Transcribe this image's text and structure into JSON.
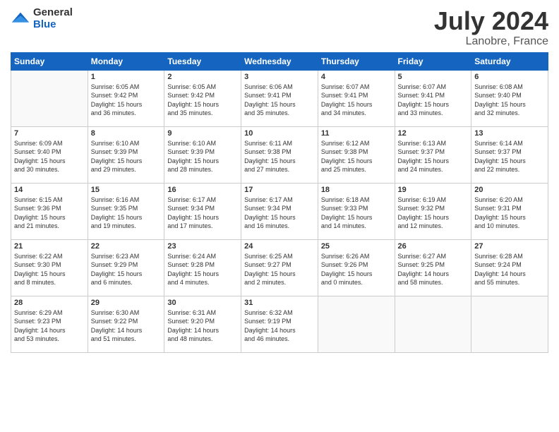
{
  "header": {
    "logo_general": "General",
    "logo_blue": "Blue",
    "month_title": "July 2024",
    "location": "Lanobre, France"
  },
  "columns": [
    "Sunday",
    "Monday",
    "Tuesday",
    "Wednesday",
    "Thursday",
    "Friday",
    "Saturday"
  ],
  "weeks": [
    [
      {
        "day": "",
        "info": ""
      },
      {
        "day": "1",
        "info": "Sunrise: 6:05 AM\nSunset: 9:42 PM\nDaylight: 15 hours\nand 36 minutes."
      },
      {
        "day": "2",
        "info": "Sunrise: 6:05 AM\nSunset: 9:42 PM\nDaylight: 15 hours\nand 35 minutes."
      },
      {
        "day": "3",
        "info": "Sunrise: 6:06 AM\nSunset: 9:41 PM\nDaylight: 15 hours\nand 35 minutes."
      },
      {
        "day": "4",
        "info": "Sunrise: 6:07 AM\nSunset: 9:41 PM\nDaylight: 15 hours\nand 34 minutes."
      },
      {
        "day": "5",
        "info": "Sunrise: 6:07 AM\nSunset: 9:41 PM\nDaylight: 15 hours\nand 33 minutes."
      },
      {
        "day": "6",
        "info": "Sunrise: 6:08 AM\nSunset: 9:40 PM\nDaylight: 15 hours\nand 32 minutes."
      }
    ],
    [
      {
        "day": "7",
        "info": "Sunrise: 6:09 AM\nSunset: 9:40 PM\nDaylight: 15 hours\nand 30 minutes."
      },
      {
        "day": "8",
        "info": "Sunrise: 6:10 AM\nSunset: 9:39 PM\nDaylight: 15 hours\nand 29 minutes."
      },
      {
        "day": "9",
        "info": "Sunrise: 6:10 AM\nSunset: 9:39 PM\nDaylight: 15 hours\nand 28 minutes."
      },
      {
        "day": "10",
        "info": "Sunrise: 6:11 AM\nSunset: 9:38 PM\nDaylight: 15 hours\nand 27 minutes."
      },
      {
        "day": "11",
        "info": "Sunrise: 6:12 AM\nSunset: 9:38 PM\nDaylight: 15 hours\nand 25 minutes."
      },
      {
        "day": "12",
        "info": "Sunrise: 6:13 AM\nSunset: 9:37 PM\nDaylight: 15 hours\nand 24 minutes."
      },
      {
        "day": "13",
        "info": "Sunrise: 6:14 AM\nSunset: 9:37 PM\nDaylight: 15 hours\nand 22 minutes."
      }
    ],
    [
      {
        "day": "14",
        "info": "Sunrise: 6:15 AM\nSunset: 9:36 PM\nDaylight: 15 hours\nand 21 minutes."
      },
      {
        "day": "15",
        "info": "Sunrise: 6:16 AM\nSunset: 9:35 PM\nDaylight: 15 hours\nand 19 minutes."
      },
      {
        "day": "16",
        "info": "Sunrise: 6:17 AM\nSunset: 9:34 PM\nDaylight: 15 hours\nand 17 minutes."
      },
      {
        "day": "17",
        "info": "Sunrise: 6:17 AM\nSunset: 9:34 PM\nDaylight: 15 hours\nand 16 minutes."
      },
      {
        "day": "18",
        "info": "Sunrise: 6:18 AM\nSunset: 9:33 PM\nDaylight: 15 hours\nand 14 minutes."
      },
      {
        "day": "19",
        "info": "Sunrise: 6:19 AM\nSunset: 9:32 PM\nDaylight: 15 hours\nand 12 minutes."
      },
      {
        "day": "20",
        "info": "Sunrise: 6:20 AM\nSunset: 9:31 PM\nDaylight: 15 hours\nand 10 minutes."
      }
    ],
    [
      {
        "day": "21",
        "info": "Sunrise: 6:22 AM\nSunset: 9:30 PM\nDaylight: 15 hours\nand 8 minutes."
      },
      {
        "day": "22",
        "info": "Sunrise: 6:23 AM\nSunset: 9:29 PM\nDaylight: 15 hours\nand 6 minutes."
      },
      {
        "day": "23",
        "info": "Sunrise: 6:24 AM\nSunset: 9:28 PM\nDaylight: 15 hours\nand 4 minutes."
      },
      {
        "day": "24",
        "info": "Sunrise: 6:25 AM\nSunset: 9:27 PM\nDaylight: 15 hours\nand 2 minutes."
      },
      {
        "day": "25",
        "info": "Sunrise: 6:26 AM\nSunset: 9:26 PM\nDaylight: 15 hours\nand 0 minutes."
      },
      {
        "day": "26",
        "info": "Sunrise: 6:27 AM\nSunset: 9:25 PM\nDaylight: 14 hours\nand 58 minutes."
      },
      {
        "day": "27",
        "info": "Sunrise: 6:28 AM\nSunset: 9:24 PM\nDaylight: 14 hours\nand 55 minutes."
      }
    ],
    [
      {
        "day": "28",
        "info": "Sunrise: 6:29 AM\nSunset: 9:23 PM\nDaylight: 14 hours\nand 53 minutes."
      },
      {
        "day": "29",
        "info": "Sunrise: 6:30 AM\nSunset: 9:22 PM\nDaylight: 14 hours\nand 51 minutes."
      },
      {
        "day": "30",
        "info": "Sunrise: 6:31 AM\nSunset: 9:20 PM\nDaylight: 14 hours\nand 48 minutes."
      },
      {
        "day": "31",
        "info": "Sunrise: 6:32 AM\nSunset: 9:19 PM\nDaylight: 14 hours\nand 46 minutes."
      },
      {
        "day": "",
        "info": ""
      },
      {
        "day": "",
        "info": ""
      },
      {
        "day": "",
        "info": ""
      }
    ]
  ]
}
